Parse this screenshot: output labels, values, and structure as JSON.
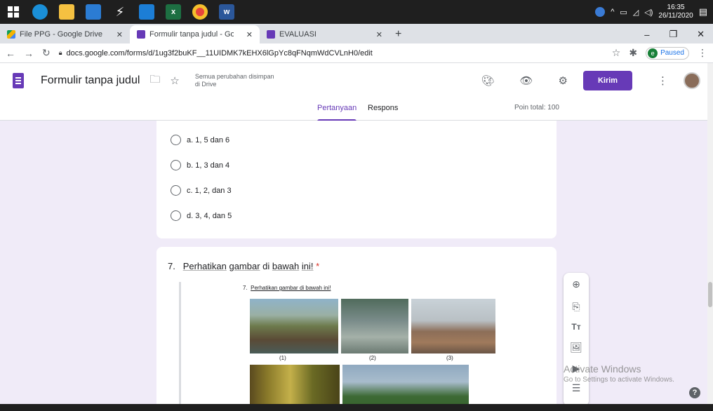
{
  "taskbar": {
    "icons": [
      "windows-start-icon",
      "edge-icon",
      "file-explorer-icon",
      "mail-icon",
      "power-automate-icon",
      "store-icon",
      "excel-icon",
      "chrome-icon",
      "word-icon"
    ],
    "time": "16:35",
    "date": "26/11/2020"
  },
  "browser": {
    "tabs": [
      {
        "label": "File PPG - Google Drive",
        "color": "#f4b400"
      },
      {
        "label": "Formulir tanpa judul - Google Fo",
        "color": "#673ab7"
      },
      {
        "label": "EVALUASI",
        "color": "#673ab7"
      }
    ],
    "url": "docs.google.com/forms/d/1ug3f2buKF__11UIDMK7kEHX6lGpYc8qFNqmWdCVLnH0/edit",
    "profile_initial": "e",
    "profile_status": "Paused"
  },
  "form_header": {
    "title": "Formulir tanpa judul",
    "saved_status": "Semua perubahan disimpan di Drive",
    "send_label": "Kirim",
    "tabs": [
      "Pertanyaan",
      "Respons"
    ],
    "points_total": "Poin total: 100",
    "accent": "#673ab7"
  },
  "question6": {
    "options": [
      "a. 1, 5 dan 6",
      "b. 1, 3 dan 4",
      "c. 1, 2, dan 3",
      "d. 3, 4, dan 5"
    ]
  },
  "question7": {
    "number": "7.",
    "text_parts": [
      "Perhatikan",
      "gambar",
      "di",
      "bawah",
      "ini!"
    ],
    "required_mark": "*",
    "image_title_number": "7.",
    "image_title": "Perhatikan gambar di bawah ini!",
    "captions": [
      "(1)",
      "(2)",
      "(3)"
    ]
  },
  "watermark": {
    "line1": "Activate Windows",
    "line2": "Go to Settings to activate Windows."
  },
  "help_label": "?"
}
